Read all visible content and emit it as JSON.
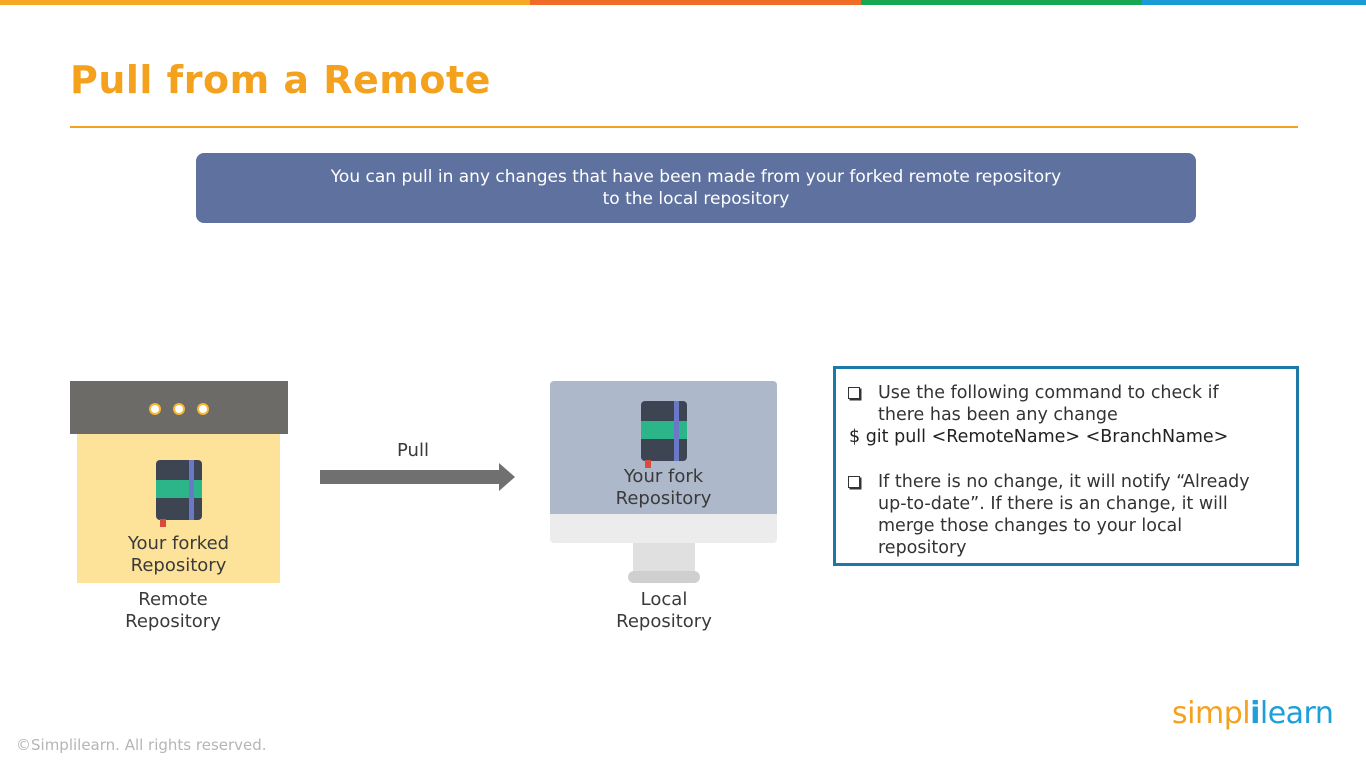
{
  "colors": {
    "top_bar": [
      "#f7a823",
      "#ef6b27",
      "#17a652",
      "#1c9ad6"
    ],
    "title": "#f4a11d",
    "title_rule": "#f4a11d",
    "banner_bg": "#5f729f",
    "infobox_border": "#1b78a7"
  },
  "slide": {
    "title": "Pull from a Remote",
    "banner_line1": "You can pull in any changes that have been made from your forked remote repository",
    "banner_line2": "to the local repository"
  },
  "diagram": {
    "remote_card_line1": "Your forked",
    "remote_card_line2": "Repository",
    "remote_caption_line1": "Remote",
    "remote_caption_line2": "Repository",
    "arrow_label": "Pull",
    "local_card_line1": "Your fork",
    "local_card_line2": "Repository",
    "local_caption_line1": "Local",
    "local_caption_line2": "Repository"
  },
  "infobox": {
    "bullet1_line1": "Use the following command to check if",
    "bullet1_line2": "there has been any change",
    "command": "$ git pull <RemoteName> <BranchName>",
    "bullet2_line1": "If there is no change, it will notify “Already",
    "bullet2_line2": "up-to-date”. If there is an change, it will",
    "bullet2_line3": "merge those changes to your local",
    "bullet2_line4": "repository"
  },
  "footer": {
    "copyright": "©Simplilearn. All rights reserved.",
    "logo_simpl": "simpl",
    "logo_bar": "i",
    "logo_learn": "learn"
  }
}
